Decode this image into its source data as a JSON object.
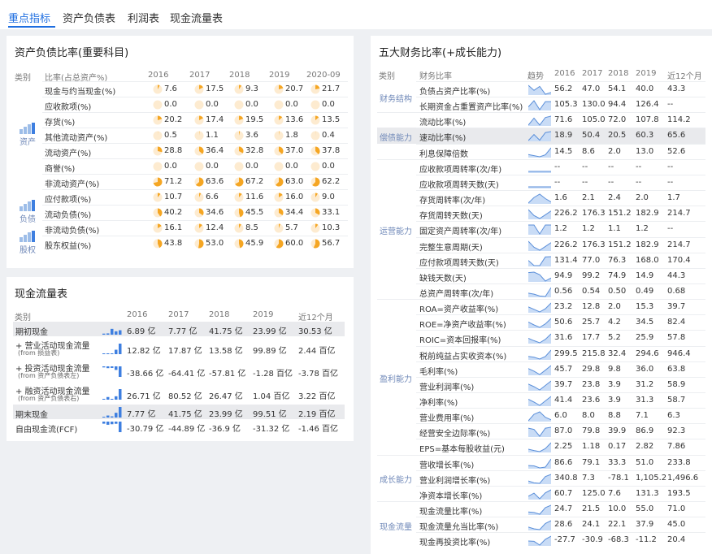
{
  "tabs": [
    "重点指标",
    "资产负债表",
    "利润表",
    "现金流量表"
  ],
  "balance": {
    "title": "资产负债比率(重要科目)",
    "headers": [
      "类别",
      "比率(占总资产%)",
      "2016",
      "2017",
      "2018",
      "2019",
      "2020-09"
    ],
    "groups": [
      {
        "label": "资产",
        "icon": "asset-bars-icon"
      },
      {
        "label": "负债",
        "icon": "liability-bars-icon"
      },
      {
        "label": "股权",
        "icon": "equity-bars-icon"
      }
    ],
    "rows": [
      {
        "name": "现金与约当现金(%)",
        "values": [
          "7.6",
          "17.5",
          "9.3",
          "20.7",
          "21.7"
        ]
      },
      {
        "name": "应收款项(%)",
        "values": [
          "0.0",
          "0.0",
          "0.0",
          "0.0",
          "0.0"
        ]
      },
      {
        "name": "存货(%)",
        "values": [
          "20.2",
          "17.4",
          "19.5",
          "13.6",
          "13.5"
        ]
      },
      {
        "name": "其他流动资产(%)",
        "values": [
          "0.5",
          "1.1",
          "3.6",
          "1.8",
          "0.4"
        ]
      },
      {
        "name": "流动资产(%)",
        "values": [
          "28.8",
          "36.4",
          "32.8",
          "37.0",
          "37.8"
        ]
      },
      {
        "name": "商誉(%)",
        "values": [
          "0.0",
          "0.0",
          "0.0",
          "0.0",
          "0.0"
        ]
      },
      {
        "name": "非流动资产(%)",
        "values": [
          "71.2",
          "63.6",
          "67.2",
          "63.0",
          "62.2"
        ]
      },
      {
        "name": "应付款项(%)",
        "values": [
          "10.7",
          "6.6",
          "11.6",
          "16.0",
          "9.0"
        ]
      },
      {
        "name": "流动负债(%)",
        "values": [
          "40.2",
          "34.6",
          "45.5",
          "34.4",
          "33.1"
        ]
      },
      {
        "name": "非流动负债(%)",
        "values": [
          "16.1",
          "12.4",
          "8.5",
          "5.7",
          "10.3"
        ]
      },
      {
        "name": "股东权益(%)",
        "values": [
          "43.8",
          "53.0",
          "45.9",
          "60.0",
          "56.7"
        ]
      }
    ]
  },
  "cashflow": {
    "title": "现金流量表",
    "headers": [
      "类别",
      "2016",
      "2017",
      "2018",
      "2019",
      "近12个月"
    ],
    "rows": [
      {
        "name": "期初现金",
        "sub": "",
        "values": [
          "6.89 亿",
          "7.77 亿",
          "41.75 亿",
          "23.99 亿",
          "30.53 亿"
        ],
        "bars": [
          0.1,
          0.12,
          0.55,
          0.32,
          0.42
        ]
      },
      {
        "name": "+ 营业活动现金流量",
        "sub": "(from 损益表)",
        "values": [
          "12.82 亿",
          "17.87 亿",
          "13.58 亿",
          "99.89 亿",
          "2.44 百亿"
        ],
        "bars": [
          0.06,
          0.08,
          0.06,
          0.42,
          1.0
        ]
      },
      {
        "name": "+ 投资活动现金流量",
        "sub": "(from 资产负债表左)",
        "values": [
          "-38.66 亿",
          "-64.41 亿",
          "-57.81 亿",
          "-1.28 百亿",
          "-3.78 百亿"
        ],
        "bars": [
          -0.1,
          -0.17,
          -0.15,
          -0.34,
          -1.0
        ]
      },
      {
        "name": "+ 融资活动现金流量",
        "sub": "(from 资产负债表右)",
        "values": [
          "26.71 亿",
          "80.52 亿",
          "26.47 亿",
          "1.04 百亿",
          "3.22 百亿"
        ],
        "bars": [
          0.08,
          0.25,
          0.08,
          0.32,
          1.0
        ]
      },
      {
        "name": "期末现金",
        "sub": "",
        "values": [
          "7.77 亿",
          "41.75 亿",
          "23.99 亿",
          "99.51 亿",
          "2.19 百亿"
        ],
        "bars": [
          0.04,
          0.19,
          0.11,
          0.45,
          1.0
        ]
      },
      {
        "name": "自由现金流(FCF)",
        "sub": "",
        "values": [
          "-30.79 亿",
          "-44.89 亿",
          "-36.9 亿",
          "-31.32 亿",
          "-1.46 百亿"
        ],
        "bars": [
          -0.2,
          -0.3,
          -0.25,
          -0.21,
          -1.0
        ]
      }
    ]
  },
  "ratios": {
    "title": "五大财务比率(+成长能力)",
    "headers": [
      "类别",
      "财务比率",
      "趋势",
      "2016",
      "2017",
      "2018",
      "2019",
      "近12个月"
    ],
    "groups": [
      {
        "label": "财务结构",
        "start": 0,
        "count": 2
      },
      {
        "label": "偿债能力",
        "start": 2,
        "count": 3
      },
      {
        "label": "运营能力",
        "start": 5,
        "count": 9
      },
      {
        "label": "盈利能力",
        "start": 14,
        "count": 10
      },
      {
        "label": "成长能力",
        "start": 24,
        "count": 3
      },
      {
        "label": "现金流量",
        "start": 27,
        "count": 3
      }
    ],
    "rows": [
      {
        "name": "负债占资产比率(%)",
        "values": [
          "56.2",
          "47.0",
          "54.1",
          "40.0",
          "43.3"
        ],
        "trend": [
          56.2,
          47.0,
          54.1,
          40.0,
          43.3
        ]
      },
      {
        "name": "长期资金占重置资产比率(%)",
        "values": [
          "105.3",
          "130.0",
          "94.4",
          "126.4",
          "--"
        ],
        "trend": [
          105.3,
          130.0,
          94.4,
          126.4,
          126.4
        ]
      },
      {
        "name": "流动比率(%)",
        "values": [
          "71.6",
          "105.0",
          "72.0",
          "107.8",
          "114.2"
        ],
        "trend": [
          71.6,
          105.0,
          72.0,
          107.8,
          114.2
        ]
      },
      {
        "name": "速动比率(%)",
        "values": [
          "18.9",
          "50.4",
          "20.5",
          "60.3",
          "65.6"
        ],
        "trend": [
          18.9,
          50.4,
          20.5,
          60.3,
          65.6
        ]
      },
      {
        "name": "利息保障倍数",
        "values": [
          "14.5",
          "8.6",
          "2.0",
          "13.0",
          "52.6"
        ],
        "trend": [
          14.5,
          8.6,
          2.0,
          13.0,
          52.6
        ]
      },
      {
        "name": "应收款项周转率(次/年)",
        "values": [
          "--",
          "--",
          "--",
          "--",
          "--"
        ],
        "trend": [
          0,
          0,
          0,
          0,
          0
        ]
      },
      {
        "name": "应收款项周转天数(天)",
        "values": [
          "--",
          "--",
          "--",
          "--",
          "--"
        ],
        "trend": [
          0,
          0,
          0,
          0,
          0
        ]
      },
      {
        "name": "存货周转率(次/年)",
        "values": [
          "1.6",
          "2.1",
          "2.4",
          "2.0",
          "1.7"
        ],
        "trend": [
          1.6,
          2.1,
          2.4,
          2.0,
          1.7
        ]
      },
      {
        "name": "存货周转天数(天)",
        "values": [
          "226.2",
          "176.3",
          "151.2",
          "182.9",
          "214.7"
        ],
        "trend": [
          226.2,
          176.3,
          151.2,
          182.9,
          214.7
        ]
      },
      {
        "name": "固定资产周转率(次/年)",
        "values": [
          "1.2",
          "1.2",
          "1.1",
          "1.2",
          "--"
        ],
        "trend": [
          1.2,
          1.2,
          1.1,
          1.2,
          1.2
        ]
      },
      {
        "name": "完整生意周期(天)",
        "values": [
          "226.2",
          "176.3",
          "151.2",
          "182.9",
          "214.7"
        ],
        "trend": [
          226.2,
          176.3,
          151.2,
          182.9,
          214.7
        ]
      },
      {
        "name": "应付款项周转天数(天)",
        "values": [
          "131.4",
          "77.0",
          "76.3",
          "168.0",
          "170.4"
        ],
        "trend": [
          131.4,
          77.0,
          76.3,
          168.0,
          170.4
        ]
      },
      {
        "name": "缺钱天数(天)",
        "values": [
          "94.9",
          "99.2",
          "74.9",
          "14.9",
          "44.3"
        ],
        "trend": [
          94.9,
          99.2,
          74.9,
          14.9,
          44.3
        ]
      },
      {
        "name": "总资产周转率(次/年)",
        "values": [
          "0.56",
          "0.54",
          "0.50",
          "0.49",
          "0.68"
        ],
        "trend": [
          0.56,
          0.54,
          0.5,
          0.49,
          0.68
        ]
      },
      {
        "name": "ROA=资产收益率(%)",
        "values": [
          "23.2",
          "12.8",
          "2.0",
          "15.3",
          "39.7"
        ],
        "trend": [
          23.2,
          12.8,
          2.0,
          15.3,
          39.7
        ]
      },
      {
        "name": "ROE=净资产收益率(%)",
        "values": [
          "50.6",
          "25.7",
          "4.2",
          "34.5",
          "82.4"
        ],
        "trend": [
          50.6,
          25.7,
          4.2,
          34.5,
          82.4
        ]
      },
      {
        "name": "ROIC=资本回报率(%)",
        "values": [
          "31.6",
          "17.7",
          "5.2",
          "25.9",
          "57.8"
        ],
        "trend": [
          31.6,
          17.7,
          5.2,
          25.9,
          57.8
        ]
      },
      {
        "name": "税前纯益占实收资本(%)",
        "values": [
          "299.5",
          "215.8",
          "32.4",
          "294.6",
          "946.4"
        ],
        "trend": [
          299.5,
          215.8,
          32.4,
          294.6,
          946.4
        ]
      },
      {
        "name": "毛利率(%)",
        "values": [
          "45.7",
          "29.8",
          "9.8",
          "36.0",
          "63.8"
        ],
        "trend": [
          45.7,
          29.8,
          9.8,
          36.0,
          63.8
        ]
      },
      {
        "name": "营业利润率(%)",
        "values": [
          "39.7",
          "23.8",
          "3.9",
          "31.2",
          "58.9"
        ],
        "trend": [
          39.7,
          23.8,
          3.9,
          31.2,
          58.9
        ]
      },
      {
        "name": "净利率(%)",
        "values": [
          "41.4",
          "23.6",
          "3.9",
          "31.3",
          "58.7"
        ],
        "trend": [
          41.4,
          23.6,
          3.9,
          31.3,
          58.7
        ]
      },
      {
        "name": "营业费用率(%)",
        "values": [
          "6.0",
          "8.0",
          "8.8",
          "7.1",
          "6.3"
        ],
        "trend": [
          6.0,
          8.0,
          8.8,
          7.1,
          6.3
        ]
      },
      {
        "name": "经营安全边际率(%)",
        "values": [
          "87.0",
          "79.8",
          "39.9",
          "86.9",
          "92.3"
        ],
        "trend": [
          87.0,
          79.8,
          39.9,
          86.9,
          92.3
        ]
      },
      {
        "name": "EPS=基本每股收益(元)",
        "values": [
          "2.25",
          "1.18",
          "0.17",
          "2.82",
          "7.86"
        ],
        "trend": [
          2.25,
          1.18,
          0.17,
          2.82,
          7.86
        ]
      },
      {
        "name": "营收增长率(%)",
        "values": [
          "86.6",
          "79.1",
          "33.3",
          "51.0",
          "233.8"
        ],
        "trend": [
          86.6,
          79.1,
          33.3,
          51.0,
          233.8
        ]
      },
      {
        "name": "营业利润增长率(%)",
        "values": [
          "340.8",
          "7.3",
          "-78.1",
          "1,105.2",
          "1,496.6"
        ],
        "trend": [
          340.8,
          7.3,
          -78.1,
          1105.2,
          1496.6
        ]
      },
      {
        "name": "净资本增长率(%)",
        "values": [
          "60.7",
          "125.0",
          "7.6",
          "131.3",
          "193.5"
        ],
        "trend": [
          60.7,
          125.0,
          7.6,
          131.3,
          193.5
        ]
      },
      {
        "name": "现金流量比率(%)",
        "values": [
          "24.7",
          "21.5",
          "10.0",
          "55.0",
          "71.0"
        ],
        "trend": [
          24.7,
          21.5,
          10.0,
          55.0,
          71.0
        ]
      },
      {
        "name": "现金流量允当比率(%)",
        "values": [
          "28.6",
          "24.1",
          "22.1",
          "37.9",
          "45.0"
        ],
        "trend": [
          28.6,
          24.1,
          22.1,
          37.9,
          45.0
        ]
      },
      {
        "name": "现金再投资比率(%)",
        "values": [
          "-27.7",
          "-30.9",
          "-68.3",
          "-11.2",
          "20.4"
        ],
        "trend": [
          -27.7,
          -30.9,
          -68.3,
          -11.2,
          20.4
        ]
      }
    ]
  },
  "colors": {
    "accent": "#1e6ee0",
    "pie": "#f5a623",
    "pieBg": "#fdebd0",
    "spark": "#5b8fd9",
    "sparkFill": "#c9dcf6",
    "bar": "#3e7fe0",
    "highlight": "#e9eaed"
  }
}
